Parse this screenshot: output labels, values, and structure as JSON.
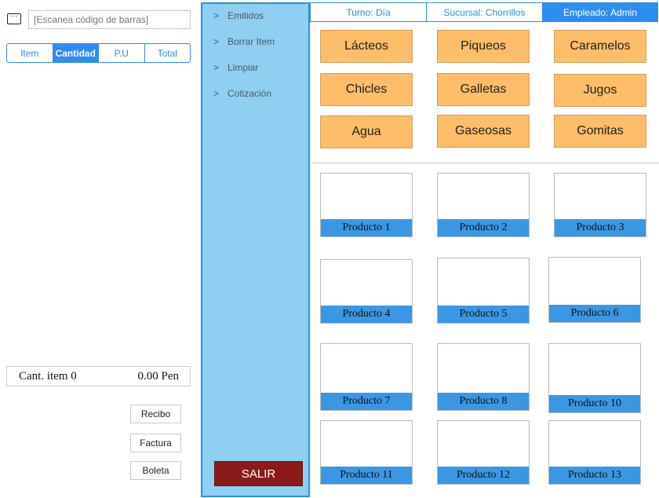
{
  "scanner": {
    "placeholder": "[Escanea código de barras]",
    "icon": "barcode-scan-icon"
  },
  "columns": [
    "Item",
    "Cantidad",
    "P.U",
    "Total"
  ],
  "active_column": "Cantidad",
  "summary": {
    "items_label": "Cant. item 0",
    "total_label": "0.00 Pen"
  },
  "documents": [
    "Recibo",
    "Factura",
    "Boleta"
  ],
  "menu": {
    "items": [
      "Emitidos",
      "Borrar Item",
      "Limpiar",
      "Cotización"
    ],
    "exit_label": "SALIR"
  },
  "header": {
    "shift": "Turno: Día",
    "branch": "Sucursal: Chorrillos",
    "employee": "Empleado: Admin"
  },
  "categories": [
    "Lácteos",
    "Piqueos",
    "Caramelos",
    "Chicles",
    "Galletas",
    "Jugos",
    "Agua",
    "Gaseosas",
    "Gomitas"
  ],
  "products": [
    "Producto 1",
    "Producto 2",
    "Producto 3",
    "Producto 4",
    "Producto 5",
    "Producto 6",
    "Producto 7",
    "Producto 8",
    "Producto 10",
    "Producto 11",
    "Producto 12",
    "Producto 13"
  ],
  "colors": {
    "accent": "#2d8cf0",
    "menu_bg": "#8fcff2",
    "category_bg": "#fdbd69",
    "product_label_bg": "#3b97e3",
    "exit_bg": "#8b1a1a"
  }
}
